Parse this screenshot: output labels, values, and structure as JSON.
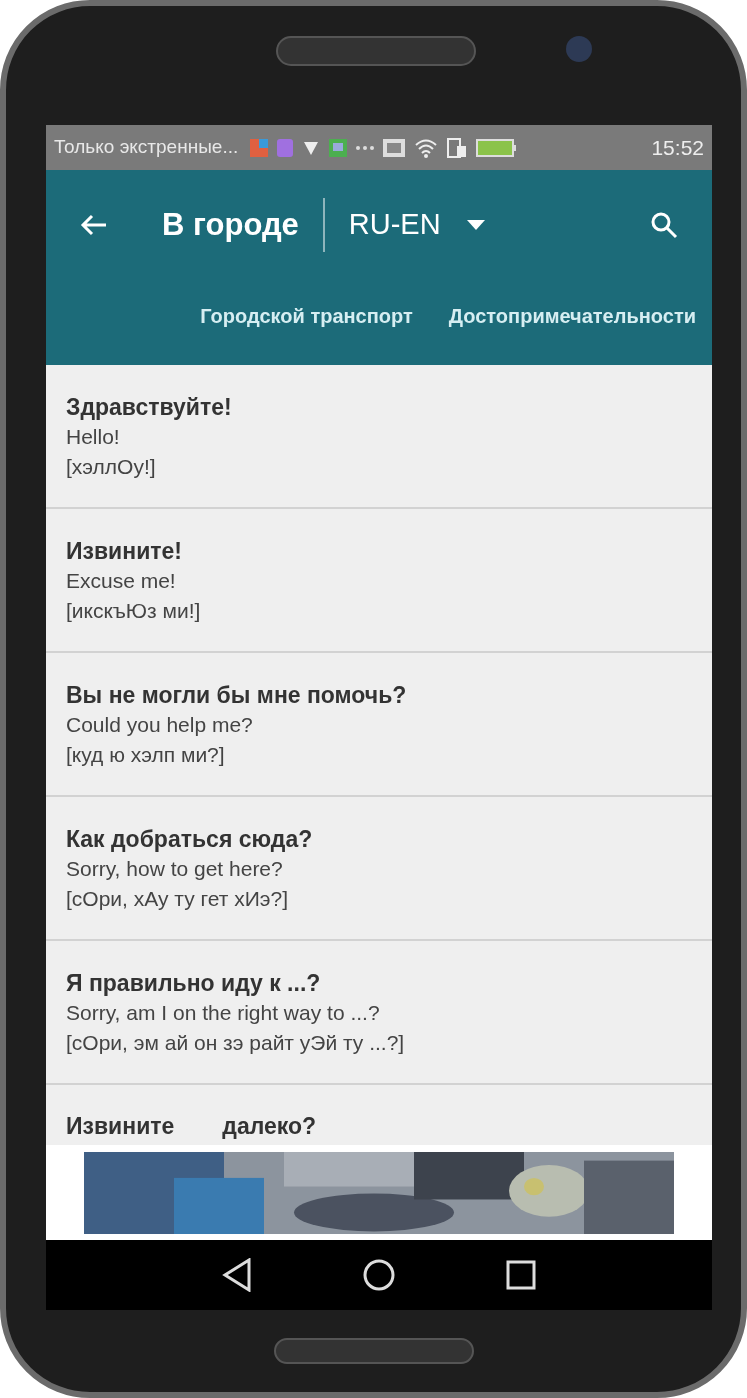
{
  "status_bar": {
    "notification": "Только экстренные...",
    "time": "15:52"
  },
  "app_bar": {
    "title": "В городе",
    "language": "RU-EN"
  },
  "tabs": [
    {
      "label": "Городской транспорт"
    },
    {
      "label": "Достопримечательности"
    }
  ],
  "phrases": [
    {
      "phrase": "Здравствуйте!",
      "translation": "Hello!",
      "transcription": "[хэллОу!]"
    },
    {
      "phrase": "Извините!",
      "translation": "Excuse me!",
      "transcription": "[икскъЮз ми!]"
    },
    {
      "phrase": "Вы не могли бы мне помочь?",
      "translation": "Could you help me?",
      "transcription": "[куд ю хэлп ми?]"
    },
    {
      "phrase": "Как добраться сюда?",
      "translation": "Sorry, how to get here?",
      "transcription": "[сОри, хАу ту гет хИэ?]"
    },
    {
      "phrase": "Я правильно иду к ...?",
      "translation": "Sorry, am I on the right way to ...?",
      "transcription": "[сОри, эм ай он зэ райт уЭй ту ...?]"
    }
  ],
  "partial_phrase": [
    "Извините",
    "далеко?"
  ]
}
